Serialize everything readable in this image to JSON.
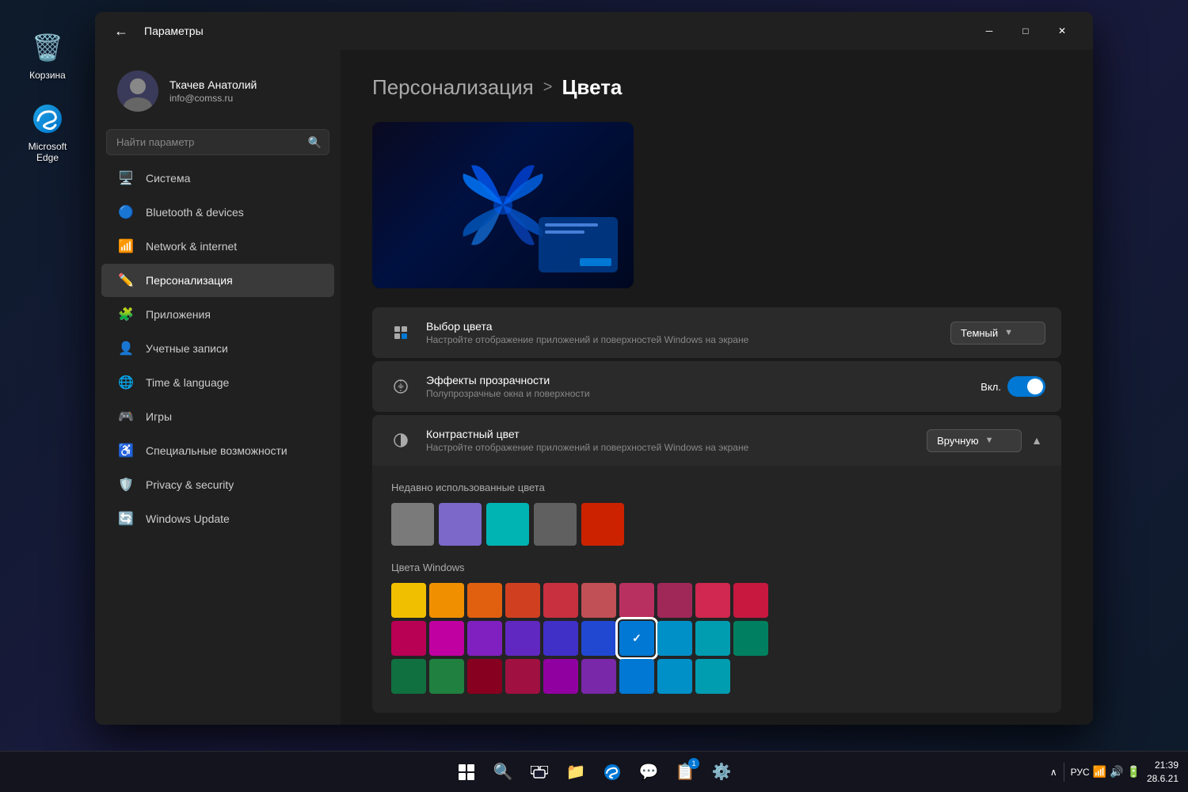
{
  "desktop": {
    "icons": [
      {
        "id": "recycle-bin",
        "label": "Корзина",
        "emoji": "🗑️"
      },
      {
        "id": "edge",
        "label": "Microsoft Edge",
        "emoji": "🌐"
      }
    ]
  },
  "taskbar": {
    "clock": "21:39",
    "date": "28.6.21",
    "lang": "РУС",
    "center_icons": [
      "⊞",
      "🔍",
      "⊟",
      "📁",
      "🌐",
      "💬",
      "📋",
      "⚙️"
    ]
  },
  "window": {
    "title": "Параметры",
    "back_button": "←"
  },
  "user": {
    "name": "Ткачев Анатолий",
    "email": "info@comss.ru"
  },
  "search": {
    "placeholder": "Найти параметр"
  },
  "nav": {
    "items": [
      {
        "id": "system",
        "label": "Система",
        "icon": "🖥️",
        "active": false
      },
      {
        "id": "bluetooth",
        "label": "Bluetooth & devices",
        "icon": "🔵",
        "active": false
      },
      {
        "id": "network",
        "label": "Network & internet",
        "icon": "📶",
        "active": false
      },
      {
        "id": "personalization",
        "label": "Персонализация",
        "icon": "✏️",
        "active": true
      },
      {
        "id": "apps",
        "label": "Приложения",
        "icon": "🧩",
        "active": false
      },
      {
        "id": "accounts",
        "label": "Учетные записи",
        "icon": "👤",
        "active": false
      },
      {
        "id": "time",
        "label": "Time & language",
        "icon": "🌐",
        "active": false
      },
      {
        "id": "gaming",
        "label": "Игры",
        "icon": "🎮",
        "active": false
      },
      {
        "id": "accessibility",
        "label": "Специальные возможности",
        "icon": "♿",
        "active": false
      },
      {
        "id": "privacy",
        "label": "Privacy & security",
        "icon": "🛡️",
        "active": false
      },
      {
        "id": "update",
        "label": "Windows Update",
        "icon": "🔄",
        "active": false
      }
    ]
  },
  "breadcrumb": {
    "parent": "Персонализация",
    "separator": ">",
    "current": "Цвета"
  },
  "settings": {
    "color_choice": {
      "icon": "🎨",
      "title": "Выбор цвета",
      "desc": "Настройте отображение приложений и поверхностей Windows на экране",
      "value": "Темный"
    },
    "transparency": {
      "icon": "✨",
      "title": "Эффекты прозрачности",
      "desc": "Полупрозрачные окна и поверхности",
      "toggle_label": "Вкл.",
      "enabled": true
    },
    "contrast": {
      "icon": "🔲",
      "title": "Контрастный цвет",
      "desc": "Настройте отображение приложений и поверхностей Windows на экране",
      "value": "Вручную",
      "expanded": true
    }
  },
  "recent_colors": {
    "title": "Недавно использованные цвета",
    "swatches": [
      "#7a7a7a",
      "#7b68c8",
      "#00b4b4",
      "#606060",
      "#cc2200"
    ]
  },
  "windows_colors": {
    "title": "Цвета Windows",
    "colors": [
      "#f0c000",
      "#f0a000",
      "#e07000",
      "#d05020",
      "#c04030",
      "#c06060",
      "#c04060",
      "#b03060",
      "#d03060",
      "#e0206060",
      "#cc1060",
      "#d000a0",
      "#9020c0",
      "#7030c0",
      "#5030c0",
      "#3050d0",
      "#0078d4",
      "#0098d0",
      "#00a0b0",
      "#008060",
      "#107040",
      "#208040",
      "#309020"
    ],
    "selected_index": 16,
    "row3_colors": [
      "#c04040",
      "#c03060",
      "#a020a0",
      "#8030b0",
      "#0078d4",
      "#0090c0",
      "#009090"
    ]
  }
}
